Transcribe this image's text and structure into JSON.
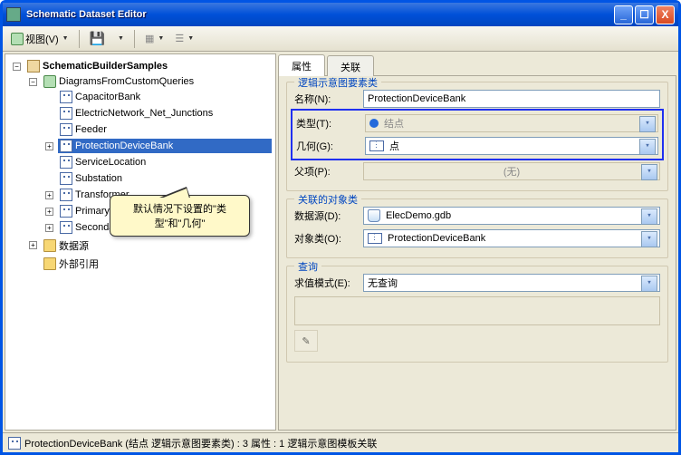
{
  "window": {
    "title": "Schematic Dataset Editor"
  },
  "toolbar": {
    "view_label": "视图(V)"
  },
  "tree": {
    "root": "SchematicBuilderSamples",
    "diagrams_folder": "DiagramsFromCustomQueries",
    "items": [
      "CapacitorBank",
      "ElectricNetwork_Net_Junctions",
      "Feeder",
      "ProtectionDeviceBank",
      "ServiceLocation",
      "Substation",
      "Transformer",
      "PrimaryLine",
      "SecondaryLine"
    ],
    "data_sources": "数据源",
    "external_refs": "外部引用"
  },
  "callout": {
    "text": "默认情况下设置的\"类型\"和\"几何\""
  },
  "tabs": {
    "tab0": "属性",
    "tab1": "关联"
  },
  "schematic_group": {
    "title": "逻辑示意图要素类",
    "name_label": "名称(N):",
    "name_value": "ProtectionDeviceBank",
    "type_label": "类型(T):",
    "type_value": "结点",
    "geom_label": "几何(G):",
    "geom_value": "点",
    "parent_label": "父项(P):",
    "parent_value": "(无)"
  },
  "assoc_group": {
    "title": "关联的对象类",
    "ds_label": "数据源(D):",
    "ds_value": "ElecDemo.gdb",
    "obj_label": "对象类(O):",
    "obj_value": "ProtectionDeviceBank"
  },
  "query_group": {
    "title": "查询",
    "mode_label": "求值模式(E):",
    "mode_value": "无查询"
  },
  "status": {
    "text": "ProtectionDeviceBank (结点 逻辑示意图要素类) : 3 属性 : 1 逻辑示意图模板关联"
  }
}
